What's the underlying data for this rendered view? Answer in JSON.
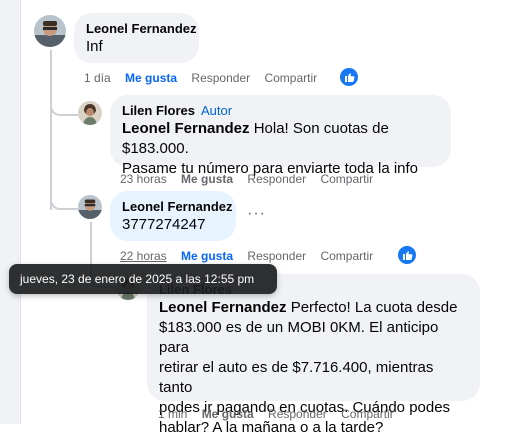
{
  "comments": [
    {
      "author": "Leonel Fernandez",
      "text": "Inf",
      "time": "1 día",
      "like": "Me gusta",
      "reply": "Responder",
      "share": "Compartir"
    },
    {
      "author": "Lilen Flores",
      "badge": "Autor",
      "mention": "Leonel Fernandez",
      "text_line1": " Hola! Son cuotas de $183.000.",
      "text_line2": "Pasame tu número para enviarte toda la info",
      "time": "23 horas",
      "like": "Me gusta",
      "reply": "Responder",
      "share": "Compartir"
    },
    {
      "author": "Leonel Fernandez",
      "text": "3777274247",
      "time": "22 horas",
      "like": "Me gusta",
      "reply": "Responder",
      "share": "Compartir"
    },
    {
      "author": "Lilen Flores",
      "mention": "Leonel Fernandez",
      "text_line1": " Perfecto! La cuota desde",
      "text_line2": "$183.000 es de un MOBI 0KM. El anticipo para",
      "text_line3": "retirar el auto es de $7.716.400, mientras tanto",
      "text_line4": "podes ir pagando en cuotas. Cuándo podes",
      "text_line5": "hablar? A la mañana o a la tarde?",
      "time": "1 min",
      "like": "Me gusta",
      "reply": "Responder",
      "share": "Compartir"
    }
  ],
  "tooltip": "jueves, 23 de enero de 2025 a las 12:55 pm",
  "more_options": "···",
  "colors": {
    "link_blue": "#0866ff",
    "badge_blue": "#0064d1",
    "bubble": "#f0f2f5",
    "bubble_active": "#e7f3ff"
  }
}
